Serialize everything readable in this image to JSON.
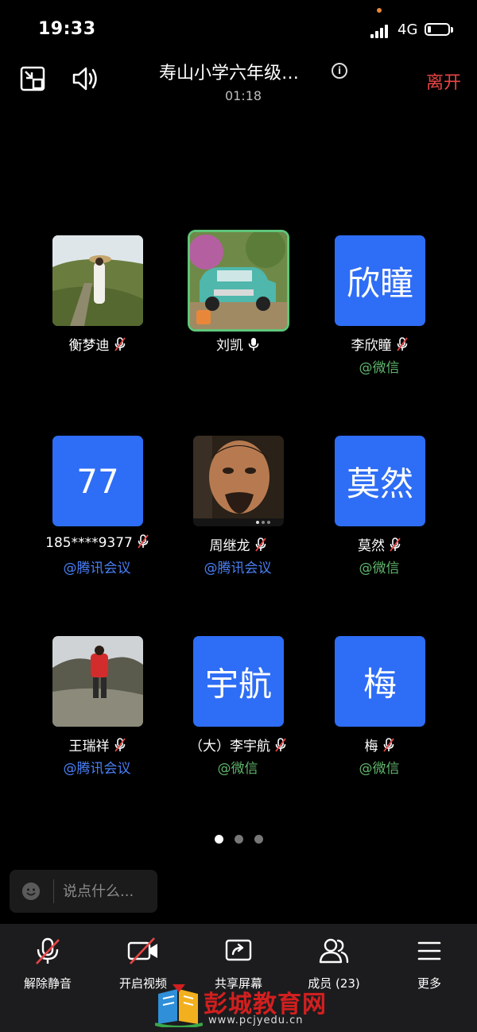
{
  "status": {
    "time": "19:33",
    "network": "4G"
  },
  "header": {
    "title": "寿山小学六年级…",
    "timer": "01:18",
    "leave_label": "离开"
  },
  "participants": [
    {
      "name": "衡梦迪",
      "source": "",
      "avatar": "photo-hillside",
      "mic": "muted"
    },
    {
      "name": "刘凯",
      "source": "",
      "avatar": "photo-truck",
      "mic": "on"
    },
    {
      "name": "李欣瞳",
      "source": "@微信",
      "avatar_text": "欣瞳",
      "mic": "muted"
    },
    {
      "name": "185****9377",
      "source": "@腾讯会议",
      "avatar_text": "77",
      "mic": "muted"
    },
    {
      "name": "周继龙",
      "source": "@腾讯会议",
      "avatar": "photo-face",
      "mic": "muted"
    },
    {
      "name": "莫然",
      "source": "@微信",
      "avatar_text": "莫然",
      "mic": "muted"
    },
    {
      "name": "王瑞祥",
      "source": "@腾讯会议",
      "avatar": "photo-outdoor",
      "mic": "muted"
    },
    {
      "name": "（大）李宇航",
      "source": "@微信",
      "avatar_text": "宇航",
      "mic": "muted"
    },
    {
      "name": "梅",
      "source": "@微信",
      "avatar_text": "梅",
      "mic": "muted"
    }
  ],
  "pager": {
    "pages": 3,
    "current": 1
  },
  "chat": {
    "placeholder": "说点什么..."
  },
  "toolbar": {
    "unmute_label": "解除静音",
    "video_label": "开启视频",
    "share_label": "共享屏幕",
    "members_label": "成员 (23)",
    "more_label": "更多"
  },
  "watermark": {
    "text": "彭城教育网",
    "url": "www.pcjyedu.cn"
  },
  "colors": {
    "accent_blue": "#2e6df5",
    "leave_red": "#e84545",
    "wechat_green": "#5fb56b",
    "tencent_blue": "#4a7ff5",
    "speaking_green": "#5fc67a"
  }
}
